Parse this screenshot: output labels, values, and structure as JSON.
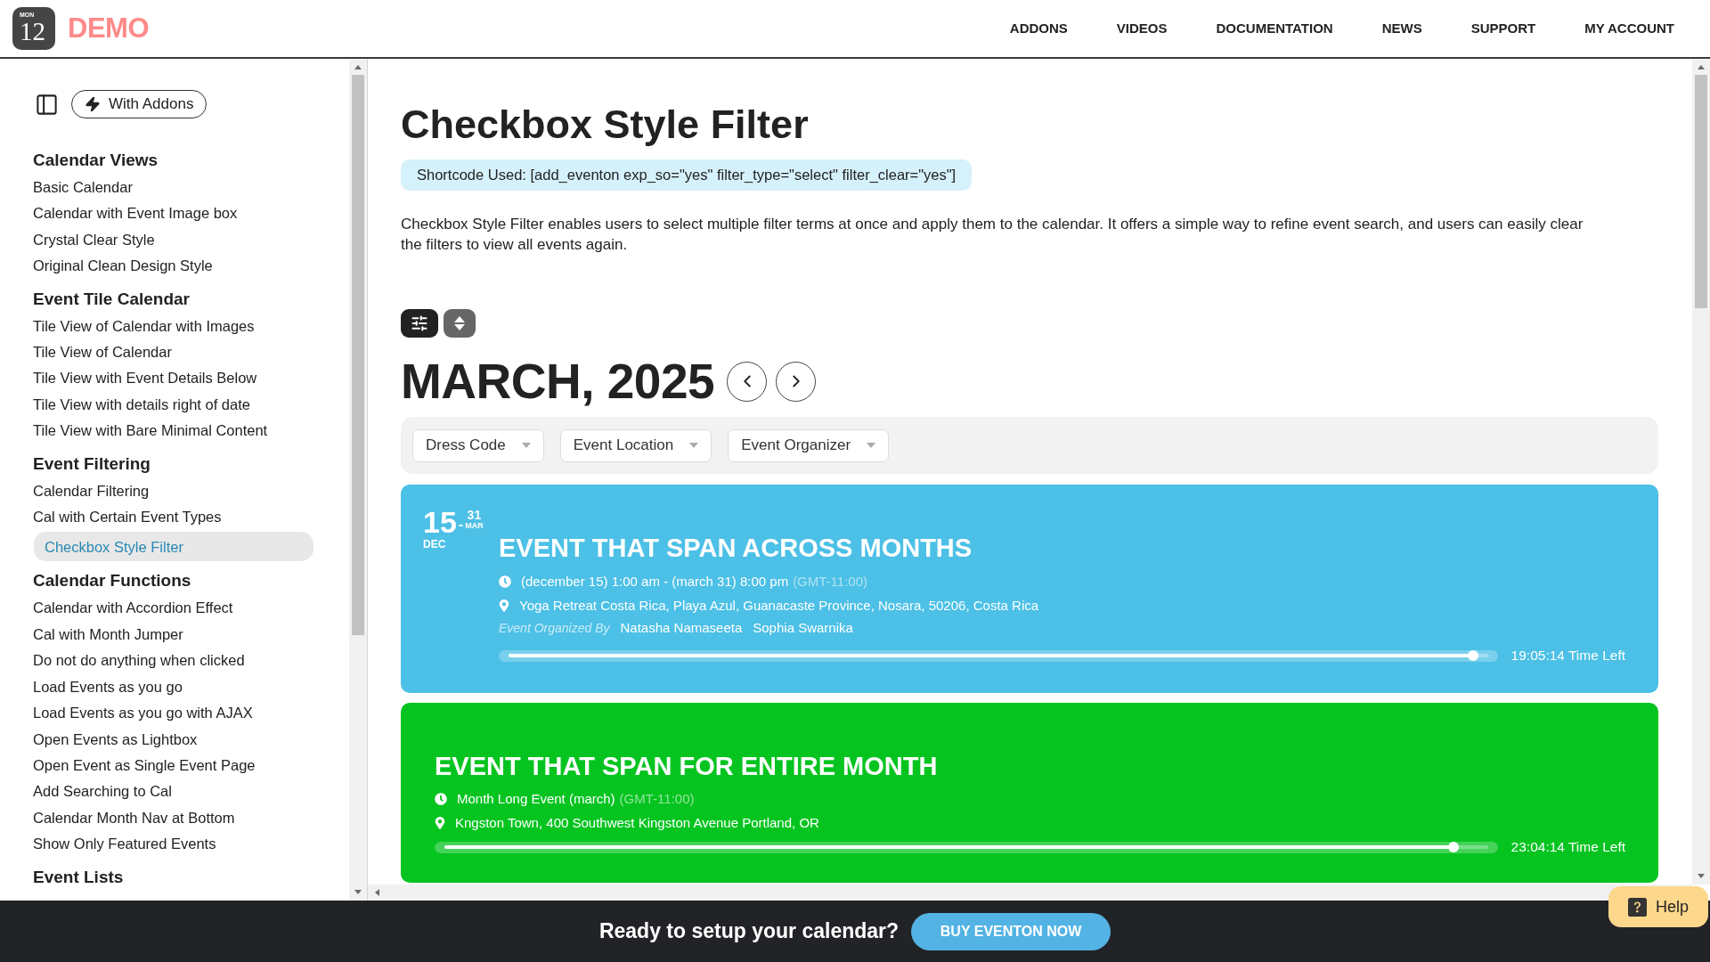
{
  "header": {
    "logo": {
      "day": "MON",
      "date": "12"
    },
    "brand": "DEMO",
    "nav": [
      "ADDONS",
      "VIDEOS",
      "DOCUMENTATION",
      "NEWS",
      "SUPPORT",
      "MY ACCOUNT"
    ]
  },
  "sidebar": {
    "addons_toggle": "With Addons",
    "sections": [
      {
        "heading": "Calendar Views",
        "items": [
          {
            "label": "Basic Calendar",
            "selected": false
          },
          {
            "label": "Calendar with Event Image box",
            "selected": false
          },
          {
            "label": "Crystal Clear Style",
            "selected": false
          },
          {
            "label": "Original Clean Design Style",
            "selected": false
          }
        ]
      },
      {
        "heading": "Event Tile Calendar",
        "items": [
          {
            "label": "Tile View of Calendar with Images",
            "selected": false
          },
          {
            "label": "Tile View of Calendar",
            "selected": false
          },
          {
            "label": "Tile View with Event Details Below",
            "selected": false
          },
          {
            "label": "Tile View with details right of date",
            "selected": false
          },
          {
            "label": "Tile View with Bare Minimal Content",
            "selected": false
          }
        ]
      },
      {
        "heading": "Event Filtering",
        "items": [
          {
            "label": "Calendar Filtering",
            "selected": false
          },
          {
            "label": "Cal with Certain Event Types",
            "selected": false
          },
          {
            "label": "Checkbox Style Filter",
            "selected": true
          }
        ]
      },
      {
        "heading": "Calendar Functions",
        "items": [
          {
            "label": "Calendar with Accordion Effect",
            "selected": false
          },
          {
            "label": "Cal with Month Jumper",
            "selected": false
          },
          {
            "label": "Do not do anything when clicked",
            "selected": false
          },
          {
            "label": "Load Events as you go",
            "selected": false
          },
          {
            "label": "Load Events as you go with AJAX",
            "selected": false
          },
          {
            "label": "Open Events as Lightbox",
            "selected": false
          },
          {
            "label": "Open Event as Single Event Page",
            "selected": false
          },
          {
            "label": "Add Searching to Cal",
            "selected": false
          },
          {
            "label": "Calendar Month Nav at Bottom",
            "selected": false
          },
          {
            "label": "Show Only Featured Events",
            "selected": false
          }
        ]
      },
      {
        "heading": "Event Lists"
      }
    ]
  },
  "page": {
    "title": "Checkbox Style Filter",
    "shortcode": "Shortcode Used: [add_eventon exp_so=\"yes\" filter_type=\"select\" filter_clear=\"yes\"]",
    "description": "Checkbox Style Filter enables users to select multiple filter terms at once and apply them to the calendar. It offers a simple way to refine event search, and users can easily clear the filters to view all events again."
  },
  "calendar": {
    "month_title": "MARCH, 2025",
    "filters": [
      "Dress Code",
      "Event Location",
      "Event Organizer"
    ],
    "events": [
      {
        "color": "#4cc0e6",
        "date": {
          "start_day": "15",
          "separator": "-",
          "end_day": "31",
          "end_month": "MAR",
          "start_month": "DEC"
        },
        "title": "EVENT THAT SPAN ACROSS MONTHS",
        "time": "(december 15) 1:00 am - (march 31) 8:00 pm",
        "timezone": "(GMT-11:00)",
        "location": "Yoga Retreat Costa Rica, Playa Azul, Guanacaste Province, Nosara, 50206, Costa Rica",
        "organizer_label": "Event Organized By",
        "organizers": [
          "Natasha Namaseeta",
          "Sophia Swarnika"
        ],
        "level": 0.985,
        "time_left": "19:05:14 Time Left"
      },
      {
        "color": "#06c420",
        "title": "EVENT THAT SPAN FOR ENTIRE MONTH",
        "time": "Month Long Event (march)",
        "timezone": "(GMT-11:00)",
        "location": "Kngston Town, 400 Southwest Kingston Avenue Portland, OR",
        "level": 0.967,
        "time_left": "23:04:14 Time Left"
      }
    ]
  },
  "cta": {
    "text": "Ready to setup your calendar?",
    "button": "BUY EVENTON NOW"
  },
  "help": {
    "label": "Help"
  }
}
